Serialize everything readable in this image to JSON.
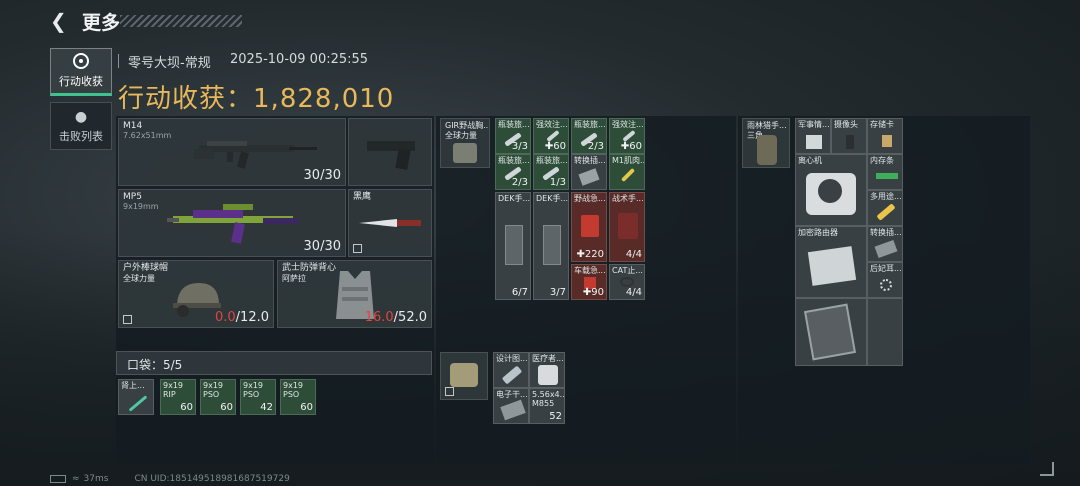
{
  "header": {
    "back_icon": "chevron-left-icon",
    "title": "更多"
  },
  "side_tabs": [
    {
      "label": "行动收获",
      "icon": "target-icon",
      "active": true
    },
    {
      "label": "击败列表",
      "icon": "skull-icon",
      "active": false
    }
  ],
  "meta": {
    "map": "零号大坝-常规",
    "time": "2025-10-09 00:25:55"
  },
  "earnings": {
    "label": "行动收获：",
    "value": "1,828,010"
  },
  "equipment": {
    "primary1": {
      "name": "M14",
      "caliber": "7.62x51mm",
      "ammo": "30/30"
    },
    "primary2": {
      "name": "MP5",
      "caliber": "9x19mm",
      "ammo": "30/30"
    },
    "melee": {
      "name": "黑鹰"
    },
    "helmet": {
      "name": "户外棒球帽",
      "sub": "全球力量",
      "dur_cur": "0.0",
      "dur_max": "/12.0"
    },
    "armor": {
      "name": "武士防弹背心",
      "sub": "阿萨拉",
      "dur_cur": "16.0",
      "dur_max": "/52.0"
    }
  },
  "pocket": {
    "label": "口袋：5/5",
    "items": [
      {
        "name": "肾上...",
        "count": ""
      },
      {
        "name": "9x19",
        "name2": "RIP",
        "count": "60"
      },
      {
        "name": "9x19",
        "name2": "PSO",
        "count": "60"
      },
      {
        "name": "9x19",
        "name2": "PSO",
        "count": "42"
      },
      {
        "name": "9x19",
        "name2": "PSO",
        "count": "60"
      }
    ]
  },
  "chest": {
    "rig": {
      "name": "GIR野战胸...",
      "sub": "全球力量"
    },
    "items": [
      {
        "name": "瓶装旅...",
        "count": "3/3"
      },
      {
        "name": "强效注...",
        "count": "✚60"
      },
      {
        "name": "瓶装旅...",
        "count": "2/3"
      },
      {
        "name": "强效注...",
        "count": "✚60"
      },
      {
        "name": "瓶装旅...",
        "count": "2/3"
      },
      {
        "name": "瓶装旅...",
        "count": "1/3"
      },
      {
        "name": "转换插...",
        "count": ""
      },
      {
        "name": "M1肌肉...",
        "count": ""
      }
    ],
    "medical": [
      {
        "name": "DEK手...",
        "count": "6/7"
      },
      {
        "name": "DEK手...",
        "count": "3/7"
      },
      {
        "name": "野战急...",
        "count": "✚220"
      },
      {
        "name": "战术手...",
        "count": "4/4"
      },
      {
        "name": "车载急...",
        "count": "✚90"
      },
      {
        "name": "CAT止...",
        "count": "4/4"
      }
    ],
    "bag_items": [
      {
        "name": "设计图...",
        "count": ""
      },
      {
        "name": "医疗者...",
        "count": ""
      },
      {
        "name": "电子干...",
        "count": ""
      },
      {
        "name": "5.56x4...",
        "name2": "M855",
        "count": "52"
      }
    ]
  },
  "backpack": {
    "bag": {
      "name": "雨林猎手...",
      "sub": "三角..."
    },
    "items": [
      {
        "name": "军事情..."
      },
      {
        "name": "摄像头"
      },
      {
        "name": "存储卡"
      },
      {
        "name": "离心机"
      },
      {
        "name": "内存条"
      },
      {
        "name": "多用途..."
      },
      {
        "name": "加密路由器"
      },
      {
        "name": "转换插..."
      },
      {
        "name": "后妃耳..."
      },
      {
        "name": ""
      }
    ]
  },
  "footer": {
    "ping": "37ms",
    "uid": "CN UID:1851495189816875197​29"
  }
}
